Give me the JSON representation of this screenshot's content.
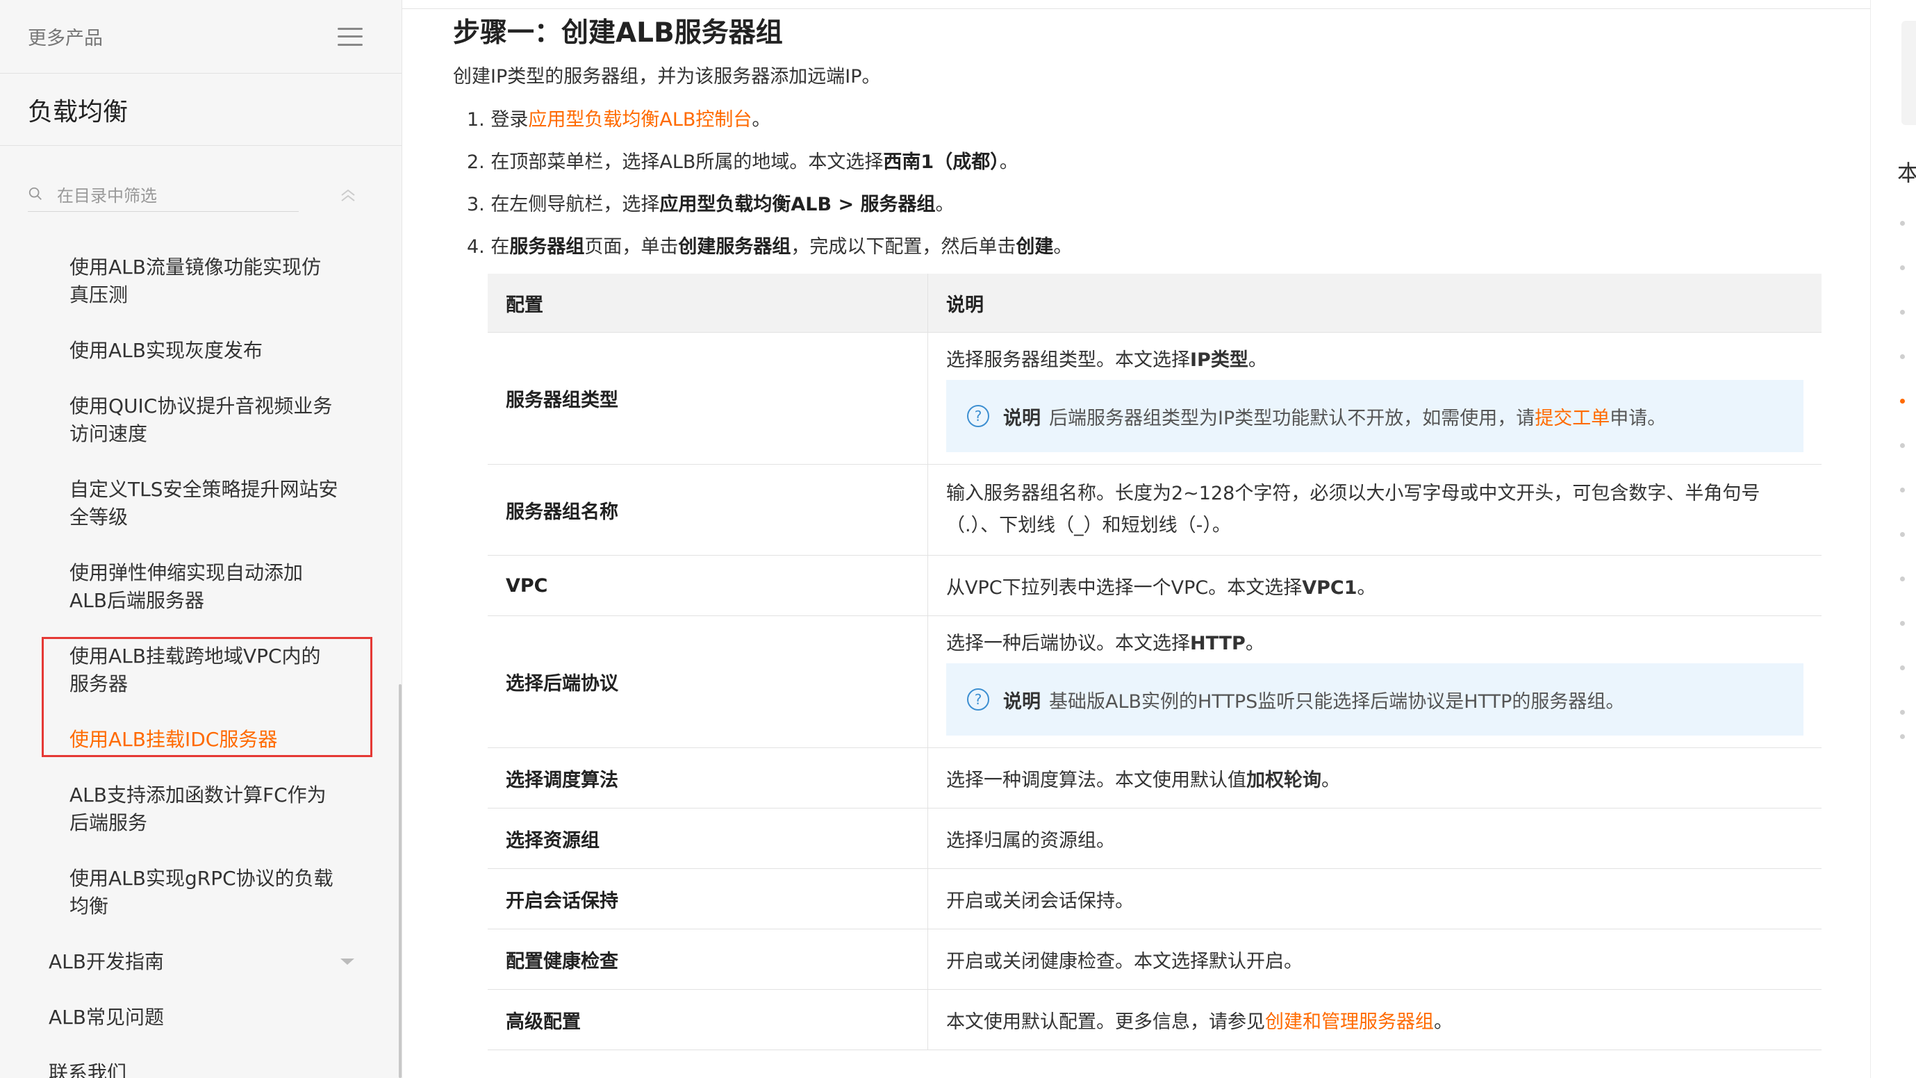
{
  "sidebar": {
    "more_products": "更多产品",
    "product_title": "负载均衡",
    "search_placeholder": "在目录中筛选",
    "items": [
      {
        "label_line1": "使用ALB流量镜像功能实现仿",
        "label_line2": "真压测"
      },
      {
        "label_line1": "使用ALB实现灰度发布",
        "label_line2": ""
      },
      {
        "label_line1": "使用QUIC协议提升音视频业务",
        "label_line2": "访问速度"
      },
      {
        "label_line1": "自定义TLS安全策略提升网站安",
        "label_line2": "全等级"
      },
      {
        "label_line1": "使用弹性伸缩实现自动添加",
        "label_line2": "ALB后端服务器"
      },
      {
        "label_line1": "使用ALB挂载跨地域VPC内的",
        "label_line2": "服务器"
      },
      {
        "label_line1": "使用ALB挂载IDC服务器",
        "label_line2": ""
      },
      {
        "label_line1": "ALB支持添加函数计算FC作为",
        "label_line2": "后端服务"
      },
      {
        "label_line1": "使用ALB实现gRPC协议的负载",
        "label_line2": "均衡"
      }
    ],
    "dev_guide": "ALB开发指南",
    "faq": "ALB常见问题",
    "contact": "联系我们"
  },
  "main": {
    "heading": "步骤一：创建ALB服务器组",
    "intro": "创建IP类型的服务器组，并为该服务器添加远端IP。",
    "step1": {
      "num": "1.",
      "pre": "登录",
      "link": "应用型负载均衡ALB控制台",
      "post": "。"
    },
    "step2": {
      "num": "2.",
      "pre": "在顶部菜单栏，选择ALB所属的地域。本文选择",
      "bold": "西南1（成都）",
      "post": "。"
    },
    "step3": {
      "num": "3.",
      "pre": "在左侧导航栏，选择",
      "bold": "应用型负载均衡ALB > 服务器组",
      "post": "。"
    },
    "step4": {
      "num": "4.",
      "pre": "在",
      "b1": "服务器组",
      "mid1": "页面，单击",
      "b2": "创建服务器组",
      "mid2": "，完成以下配置，然后单击",
      "b3": "创建",
      "post": "。"
    },
    "table": {
      "col1": "配置",
      "col2": "说明",
      "rows": {
        "type": {
          "key": "服务器组类型",
          "pre": "选择服务器组类型。本文选择",
          "bold": "IP类型",
          "post": "。",
          "note_label": "说明",
          "note_pre": "后端服务器组类型为IP类型功能默认不开放，如需使用，请",
          "note_link": "提交工单",
          "note_post": "申请。"
        },
        "name": {
          "key": "服务器组名称",
          "line1": "输入服务器组名称。长度为2~128个字符，必须以大小写字母或中文开头，可包含数字、半角句号",
          "line2": "（.）、下划线（_）和短划线（-）。"
        },
        "vpc": {
          "key": "VPC",
          "pre": "从VPC下拉列表中选择一个VPC。本文选择",
          "bold": "VPC1",
          "post": "。"
        },
        "protocol": {
          "key": "选择后端协议",
          "pre": "选择一种后端协议。本文选择",
          "bold": "HTTP",
          "post": "。",
          "note_label": "说明",
          "note_text": "基础版ALB实例的HTTPS监听只能选择后端协议是HTTP的服务器组。"
        },
        "algo": {
          "key": "选择调度算法",
          "pre": "选择一种调度算法。本文使用默认值",
          "bold": "加权轮询",
          "post": "。"
        },
        "rg": {
          "key": "选择资源组",
          "text": "选择归属的资源组。"
        },
        "session": {
          "key": "开启会话保持",
          "text": "开启或关闭会话保持。"
        },
        "health": {
          "key": "配置健康检查",
          "text": "开启或关闭健康检查。本文选择默认开启。"
        },
        "advanced": {
          "key": "高级配置",
          "pre": "本文使用默认配置。更多信息，请参见",
          "link": "创建和管理服务器组",
          "post": "。"
        }
      }
    }
  },
  "right_rail": {
    "char": "本"
  },
  "colors": {
    "accent": "#ff6a00",
    "highlight_border": "#e53935",
    "note_bg": "#ebf5fd",
    "info_icon": "#3d8fd1"
  }
}
